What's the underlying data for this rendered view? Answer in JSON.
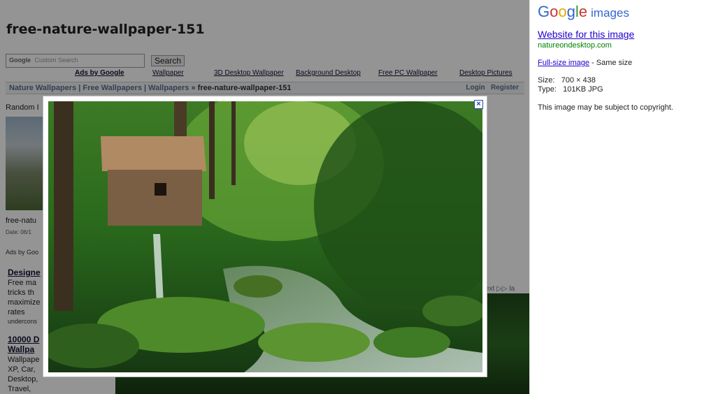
{
  "page": {
    "title": "free-nature-wallpaper-151",
    "search_placeholder": "Custom Search",
    "search_logo": "Google",
    "search_button": "Search",
    "ads_label": "Ads by Google",
    "ad_links": [
      "Wallpaper",
      "3D Desktop Wallpaper",
      "Background Desktop",
      "Free PC Wallpaper",
      "Desktop Pictures"
    ],
    "breadcrumb_links": "Nature Wallpapers | Free Wallpapers | Wallpapers",
    "breadcrumb_sep": "»",
    "breadcrumb_current": "free-nature-wallpaper-151",
    "login": "Login",
    "register": "Register",
    "random_label": "Random I",
    "thumb_name": "free-natu",
    "thumb_date": "Date: 06/1",
    "ads_by": "Ads by Goo",
    "ads": [
      {
        "title": "Designe",
        "text": "Free ma tricks th maximize rates",
        "url": "undercons"
      },
      {
        "title": "10000 D",
        "title2": "Wallpa",
        "text": "Wallpape XP, Car, Desktop, Travel, Movies, Ar"
      }
    ],
    "next_link": "ext ▷▷ la"
  },
  "lightbox": {
    "close_label": "×"
  },
  "panel": {
    "logo_letters": [
      "G",
      "o",
      "o",
      "g",
      "l",
      "e"
    ],
    "logo_suffix": "images",
    "website_link": "Website for this image",
    "domain": "natureondesktop.com",
    "fullsize_link": "Full-size image",
    "fullsize_note": "- Same size",
    "size_label": "Size:",
    "size_value": "700 × 438",
    "type_label": "Type:",
    "type_value": "101KB JPG",
    "copyright": "This image may be subject to copyright."
  }
}
